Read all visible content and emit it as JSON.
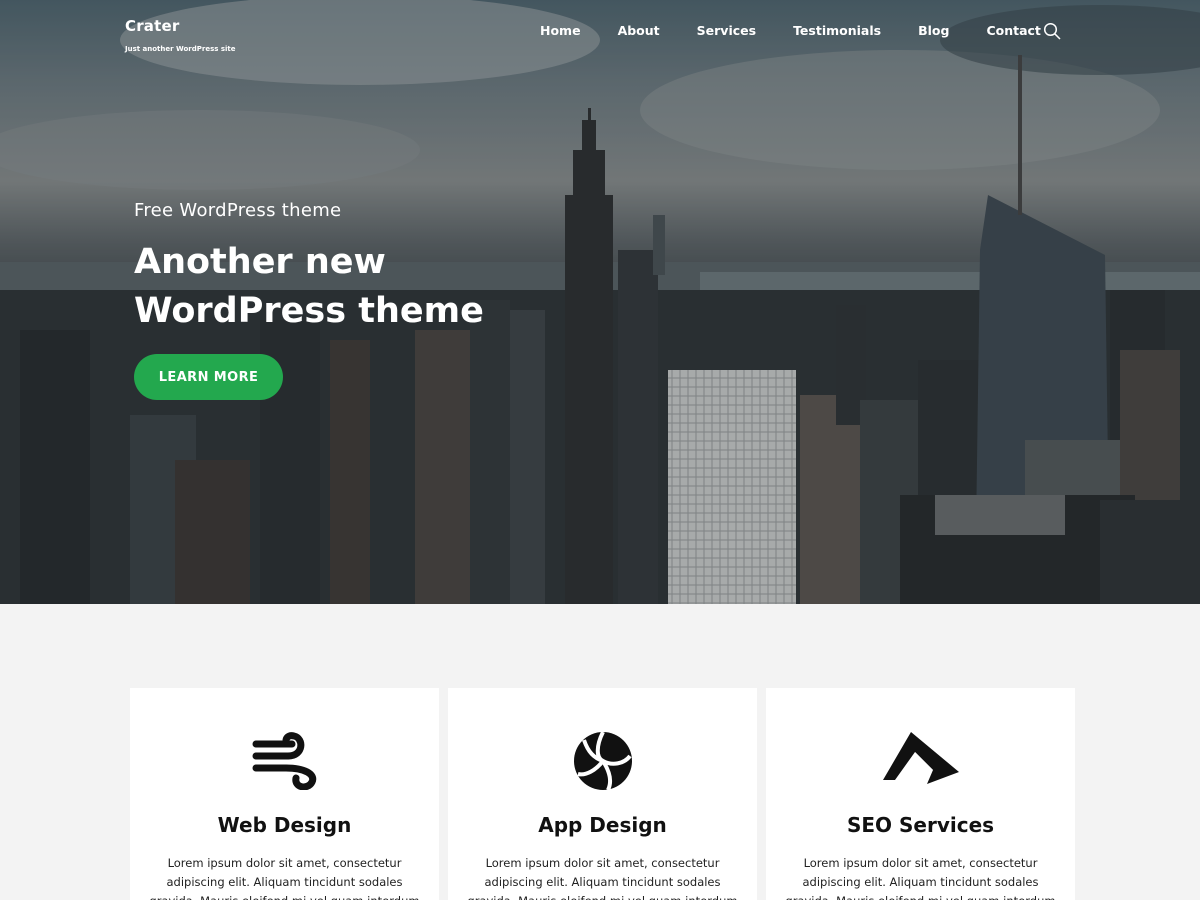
{
  "site": {
    "title": "Crater",
    "tagline": "Just another WordPress site"
  },
  "nav": {
    "items": [
      "Home",
      "About",
      "Services",
      "Testimonials",
      "Blog",
      "Contact"
    ],
    "search_icon": "search-icon"
  },
  "hero": {
    "kicker": "Free WordPress theme",
    "title": "Another new WordPress theme",
    "cta_label": "LEARN MORE",
    "cta_color": "#23a84e"
  },
  "services": [
    {
      "icon": "wind-icon",
      "title": "Web Design",
      "text": "Lorem ipsum dolor sit amet, consectetur adipiscing elit. Aliquam tincidunt sodales gravida. Mauris eleifend mi vel quam interdum consectetur."
    },
    {
      "icon": "volleyball-icon",
      "title": "App Design",
      "text": "Lorem ipsum dolor sit amet, consectetur adipiscing elit. Aliquam tincidunt sodales gravida. Mauris eleifend mi vel quam interdum consectetur."
    },
    {
      "icon": "mountain-logo-icon",
      "title": "SEO Services",
      "text": "Lorem ipsum dolor sit amet, consectetur adipiscing elit. Aliquam tincidunt sodales gravida. Mauris eleifend mi vel quam interdum consectetur."
    }
  ]
}
